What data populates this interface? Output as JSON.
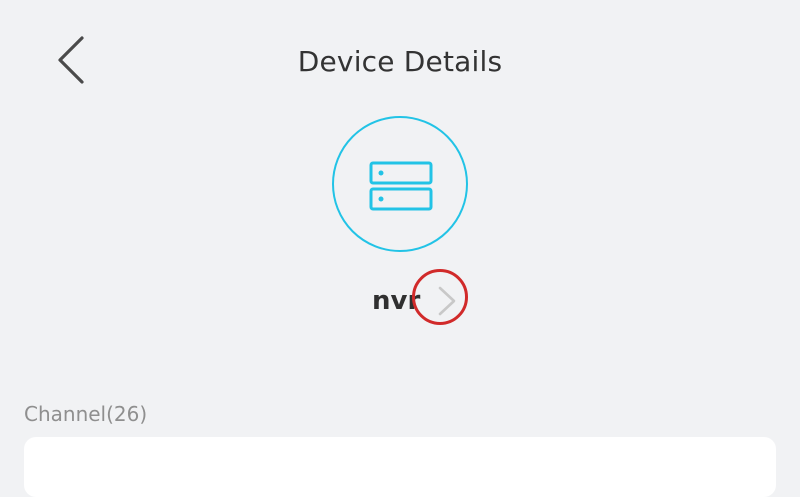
{
  "header": {
    "title": "Device Details",
    "back_icon": "chevron-left-icon"
  },
  "device": {
    "icon": "server-icon",
    "name": "nvr",
    "name_action_icon": "chevron-right-icon",
    "accent_color": "#22c3e6",
    "annotation_color": "#d12a2a"
  },
  "channels": {
    "label": "Channel(26)"
  }
}
